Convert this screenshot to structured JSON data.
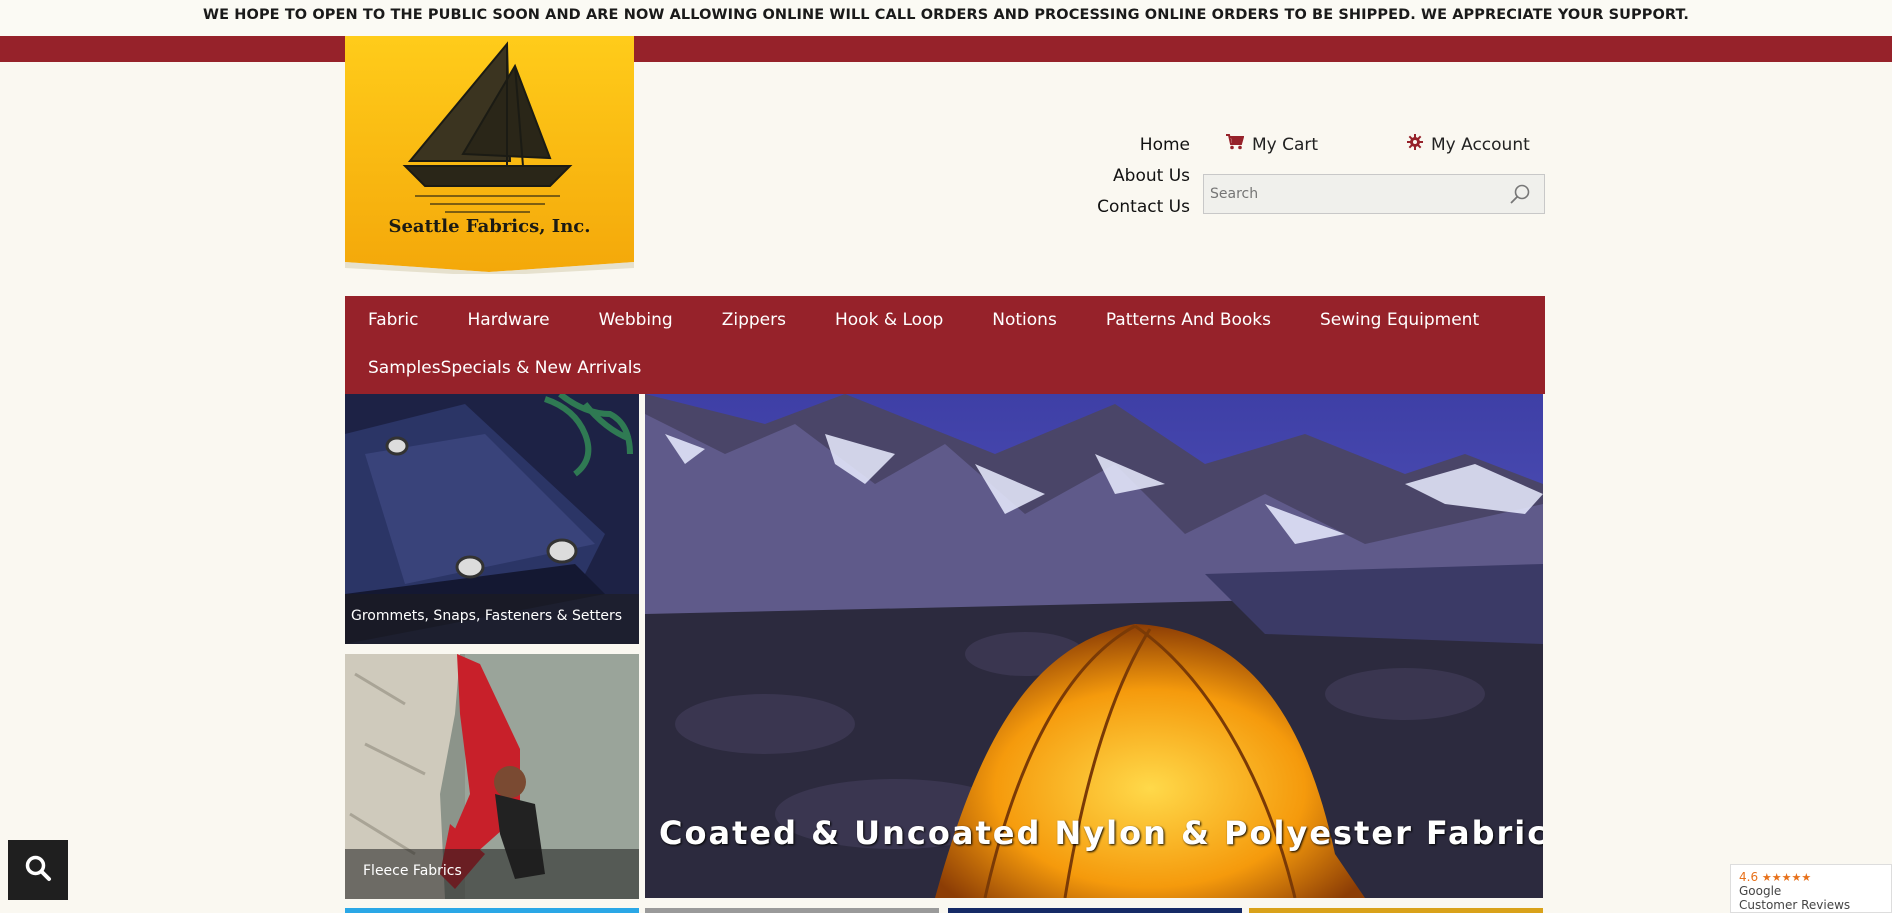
{
  "announcement": "WE HOPE TO OPEN TO THE PUBLIC SOON AND ARE NOW ALLOWING ONLINE WILL CALL ORDERS AND PROCESSING ONLINE ORDERS TO BE SHIPPED. WE APPRECIATE YOUR SUPPORT.",
  "logo": {
    "text": "Seattle Fabrics, Inc."
  },
  "header": {
    "links": [
      "Home",
      "About Us",
      "Contact Us"
    ],
    "cart_label": "My Cart",
    "account_label": "My Account",
    "search_placeholder": "Search"
  },
  "nav": {
    "items": [
      "Fabric",
      "Hardware",
      "Webbing",
      "Zippers",
      "Hook & Loop",
      "Notions",
      "Patterns And Books",
      "Sewing Equipment",
      "Samples",
      "Specials & New Arrivals"
    ]
  },
  "tiles": {
    "grommets": "Grommets, Snaps, Fasteners & Setters",
    "fleece": "Fleece Fabrics",
    "hero": "Coated & Uncoated Nylon & Polyester Fabrics"
  },
  "google_badge": {
    "rating": "4.6",
    "stars": "★★★★★",
    "brand": "Google",
    "label": "Customer Reviews"
  },
  "colors": {
    "brand_red": "#96222a",
    "logo_yellow": "#f7b20c",
    "background": "#faf8f1"
  },
  "icons": {
    "cart": "cart-icon",
    "account": "gear-icon",
    "search": "search-icon",
    "floating_search": "magnifier-icon"
  }
}
